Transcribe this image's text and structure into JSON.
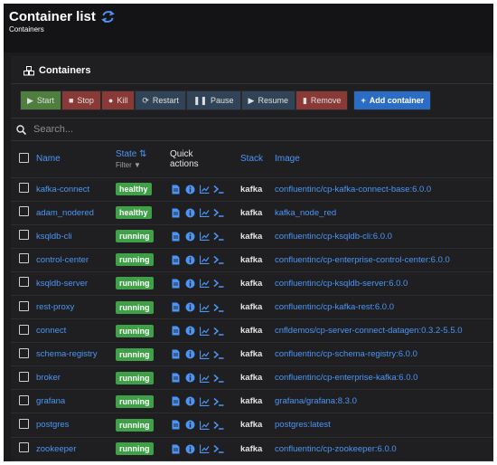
{
  "header": {
    "title": "Container list",
    "subtitle": "Containers"
  },
  "panel": {
    "title": "Containers",
    "toolbar": [
      {
        "label": "Start",
        "icon": "play-icon",
        "glyph": "▶",
        "style": "green"
      },
      {
        "label": "Stop",
        "icon": "stop-icon",
        "glyph": "■",
        "style": "red"
      },
      {
        "label": "Kill",
        "icon": "bomb-icon",
        "glyph": "●",
        "style": "red"
      },
      {
        "label": "Restart",
        "icon": "refresh-icon",
        "glyph": "⟳",
        "style": "slate"
      },
      {
        "label": "Pause",
        "icon": "pause-icon",
        "glyph": "❚❚",
        "style": "slate"
      },
      {
        "label": "Resume",
        "icon": "play-icon",
        "glyph": "▶",
        "style": "slate"
      },
      {
        "label": "Remove",
        "icon": "trash-icon",
        "glyph": "▮",
        "style": "red"
      }
    ],
    "add_button": "Add container",
    "search_placeholder": "Search..."
  },
  "table": {
    "columns": {
      "name": "Name",
      "state": "State",
      "filter": "Filter",
      "quick_line1": "Quick",
      "quick_line2": "actions",
      "stack": "Stack",
      "image": "Image"
    },
    "rows": [
      {
        "name": "kafka-connect",
        "state": "healthy",
        "stack": "kafka",
        "image": "confluentinc/cp-kafka-connect-base:6.0.0"
      },
      {
        "name": "adam_nodered",
        "state": "healthy",
        "stack": "kafka",
        "image": "kafka_node_red"
      },
      {
        "name": "ksqldb-cli",
        "state": "running",
        "stack": "kafka",
        "image": "confluentinc/cp-ksqldb-cli:6.0.0"
      },
      {
        "name": "control-center",
        "state": "running",
        "stack": "kafka",
        "image": "confluentinc/cp-enterprise-control-center:6.0.0"
      },
      {
        "name": "ksqldb-server",
        "state": "running",
        "stack": "kafka",
        "image": "confluentinc/cp-ksqldb-server:6.0.0"
      },
      {
        "name": "rest-proxy",
        "state": "running",
        "stack": "kafka",
        "image": "confluentinc/cp-kafka-rest:6.0.0"
      },
      {
        "name": "connect",
        "state": "running",
        "stack": "kafka",
        "image": "cnfldemos/cp-server-connect-datagen:0.3.2-5.5.0"
      },
      {
        "name": "schema-registry",
        "state": "running",
        "stack": "kafka",
        "image": "confluentinc/cp-schema-registry:6.0.0"
      },
      {
        "name": "broker",
        "state": "running",
        "stack": "kafka",
        "image": "confluentinc/cp-enterprise-kafka:6.0.0"
      },
      {
        "name": "grafana",
        "state": "running",
        "stack": "kafka",
        "image": "grafana/grafana:8.3.0"
      },
      {
        "name": "postgres",
        "state": "running",
        "stack": "kafka",
        "image": "postgres:latest"
      },
      {
        "name": "zookeeper",
        "state": "running",
        "stack": "kafka",
        "image": "confluentinc/cp-zookeeper:6.0.0"
      }
    ]
  },
  "colors": {
    "accent": "#4c95f5",
    "healthy": "#3fa047",
    "background": "#1b1b1d"
  }
}
